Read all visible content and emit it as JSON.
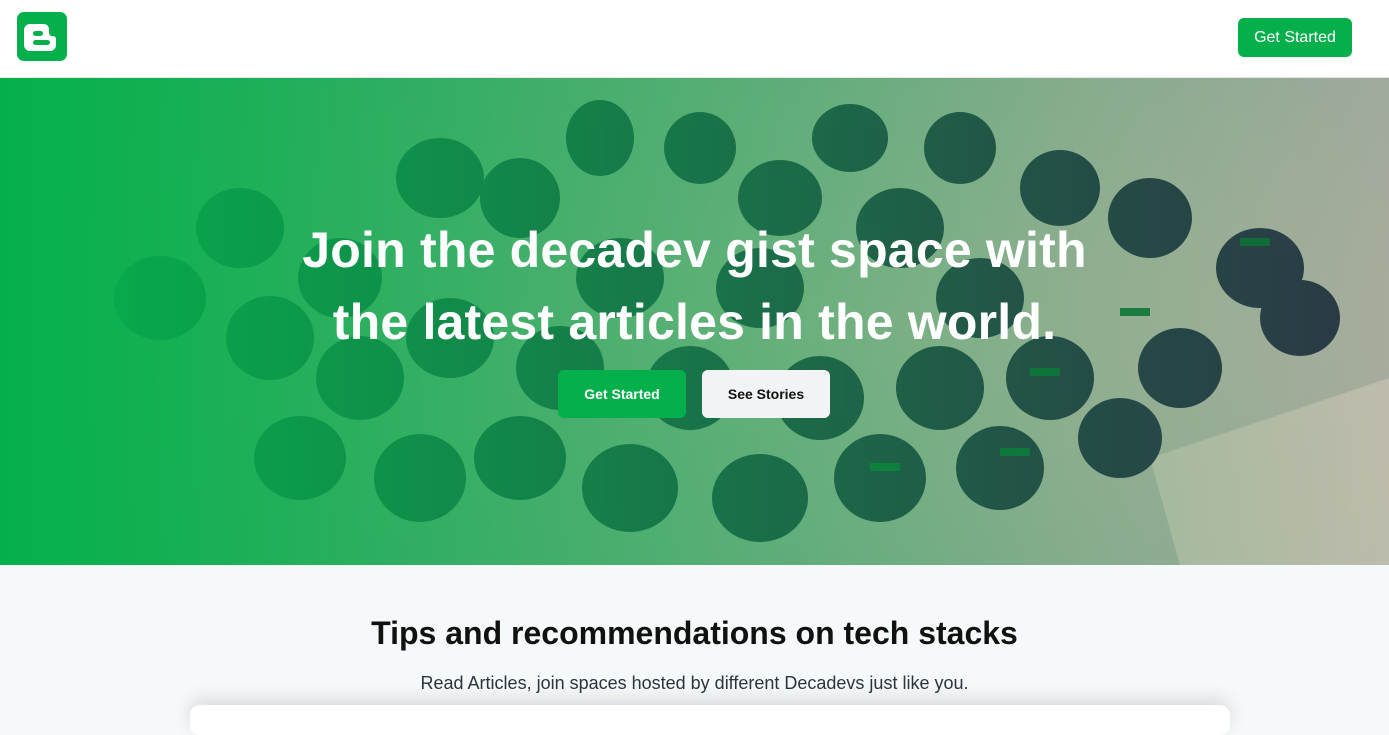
{
  "nav": {
    "logo_icon": "blogger-logo-icon",
    "cta_label": "Get Started"
  },
  "hero": {
    "title_line1": "Join the decadev gist space with",
    "title_line2": "the latest articles in the world.",
    "primary_label": "Get Started",
    "secondary_label": "See Stories",
    "accent": "#05b04c"
  },
  "section": {
    "title": "Tips and recommendations on tech stacks",
    "subtitle": "Read Articles, join spaces hosted by different Decadevs just like you."
  }
}
